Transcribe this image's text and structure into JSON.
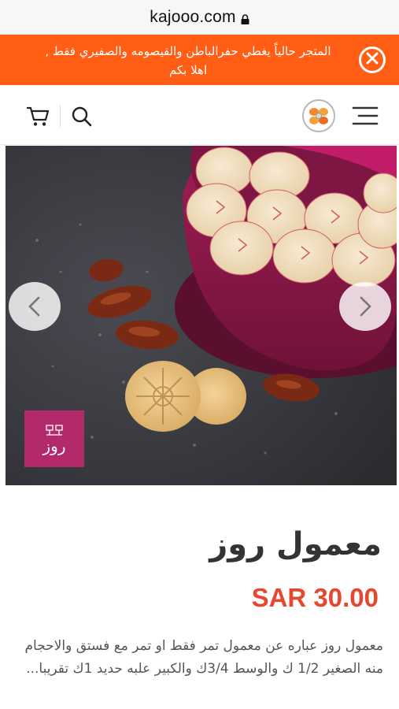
{
  "browser": {
    "url": "kajooo.com",
    "lock_icon": "lock-icon"
  },
  "notice": {
    "text": "المتجر حالياً يغطي حفرالباطن والقيصومه والصفيري فقط , اهلا بكم",
    "close_icon": "close-icon",
    "bg_color": "#ff5e14"
  },
  "navbar": {
    "cart_icon": "cart-icon",
    "search_icon": "search-icon",
    "logo_icon": "store-logo",
    "menu_icon": "hamburger-menu-icon"
  },
  "hero": {
    "prev_icon": "chevron-left-icon",
    "next_icon": "chevron-right-icon",
    "brand_badge_text": "روز"
  },
  "product": {
    "title": "معمول روز",
    "price": "SAR 30.00",
    "price_color": "#e8472f",
    "description": "معمول روز عباره عن معمول تمر فقط او تمر مع فستق والاحجام منه الصغير 1/2 ك والوسط 3/4ك والكبير علبه حديد 1ك تقريبا..."
  }
}
